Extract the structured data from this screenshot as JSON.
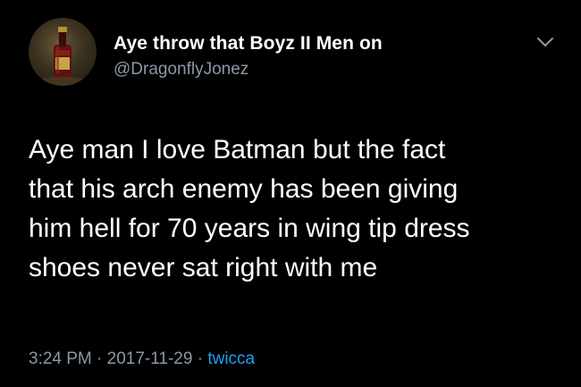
{
  "author": {
    "display_name": "Aye throw that Boyz II Men on",
    "handle": "@DragonflyJonez",
    "avatar_icon": "avatar-bottle-photo"
  },
  "menu": {
    "icon": "chevron-down-icon"
  },
  "tweet": {
    "lines": [
      "Aye man I love Batman but the fact",
      "that his arch enemy has been giving",
      "him hell for 70 years in wing tip dress",
      "shoes never sat right with me"
    ]
  },
  "meta": {
    "time": "3:24 PM",
    "separator": "·",
    "date": "2017-11-29",
    "source": "twicca"
  },
  "colors": {
    "background": "#000000",
    "text": "#ffffff",
    "secondary": "#8b98a5",
    "link": "#1da1f2"
  }
}
